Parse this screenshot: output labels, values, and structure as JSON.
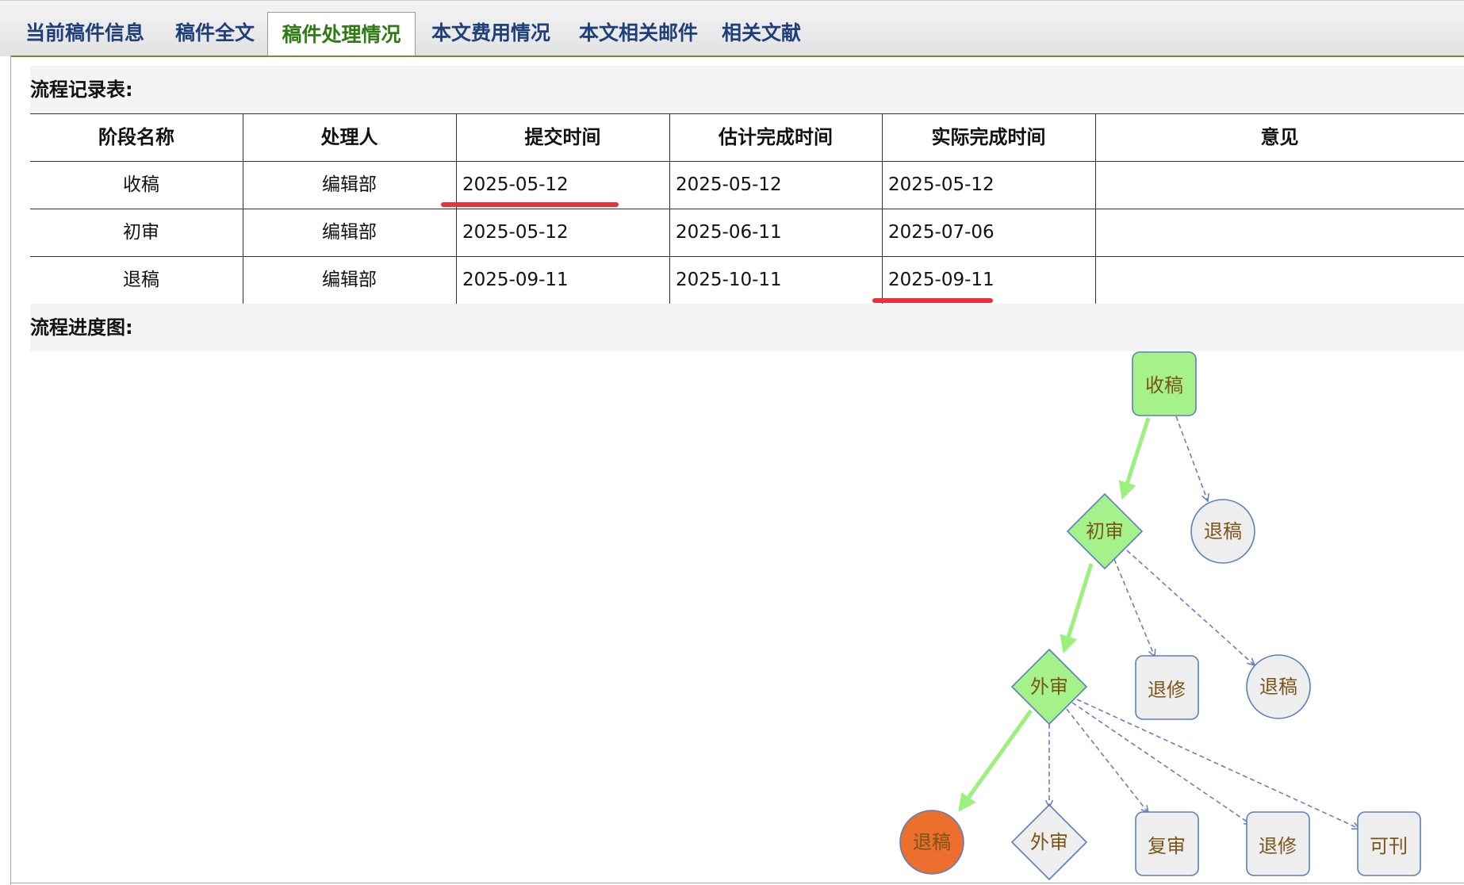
{
  "tabs": [
    {
      "label": "当前稿件信息"
    },
    {
      "label": "稿件全文"
    },
    {
      "label": "稿件处理情况"
    },
    {
      "label": "本文费用情况"
    },
    {
      "label": "本文相关邮件"
    },
    {
      "label": "相关文献"
    }
  ],
  "record": {
    "title": "流程记录表:",
    "headers": [
      "阶段名称",
      "处理人",
      "提交时间",
      "估计完成时间",
      "实际完成时间",
      "意见"
    ],
    "rows": [
      {
        "stage": "收稿",
        "handler": "编辑部",
        "submitted": "2025-05-12",
        "estimated": "2025-05-12",
        "actual": "2025-05-12",
        "opinion": ""
      },
      {
        "stage": "初审",
        "handler": "编辑部",
        "submitted": "2025-05-12",
        "estimated": "2025-06-11",
        "actual": "2025-07-06",
        "opinion": ""
      },
      {
        "stage": "退稿",
        "handler": "编辑部",
        "submitted": "2025-09-11",
        "estimated": "2025-10-11",
        "actual": "2025-09-11",
        "opinion": ""
      }
    ]
  },
  "flow": {
    "title": "流程进度图:",
    "nodes": {
      "n_receive": "收稿",
      "n_initial": "初审",
      "n_reject1": "退稿",
      "n_external": "外审",
      "n_revise1": "退修",
      "n_reject2": "退稿",
      "n_reject_final": "退稿",
      "n_external2": "外审",
      "n_rereview": "复审",
      "n_revise2": "退修",
      "n_publish": "可刊"
    }
  },
  "colors": {
    "active_node": "#a6f28a",
    "inactive_node": "#eeeeee",
    "node_border": "#5b7fbd",
    "current_node": "#ec6f2d",
    "active_path": "#9cf07e",
    "option_path": "#6680c0",
    "node_text": "#7a5418",
    "tab_text": "#1e3f7a",
    "active_tab_text": "#2e7b14",
    "highlight": "#e8313a"
  }
}
